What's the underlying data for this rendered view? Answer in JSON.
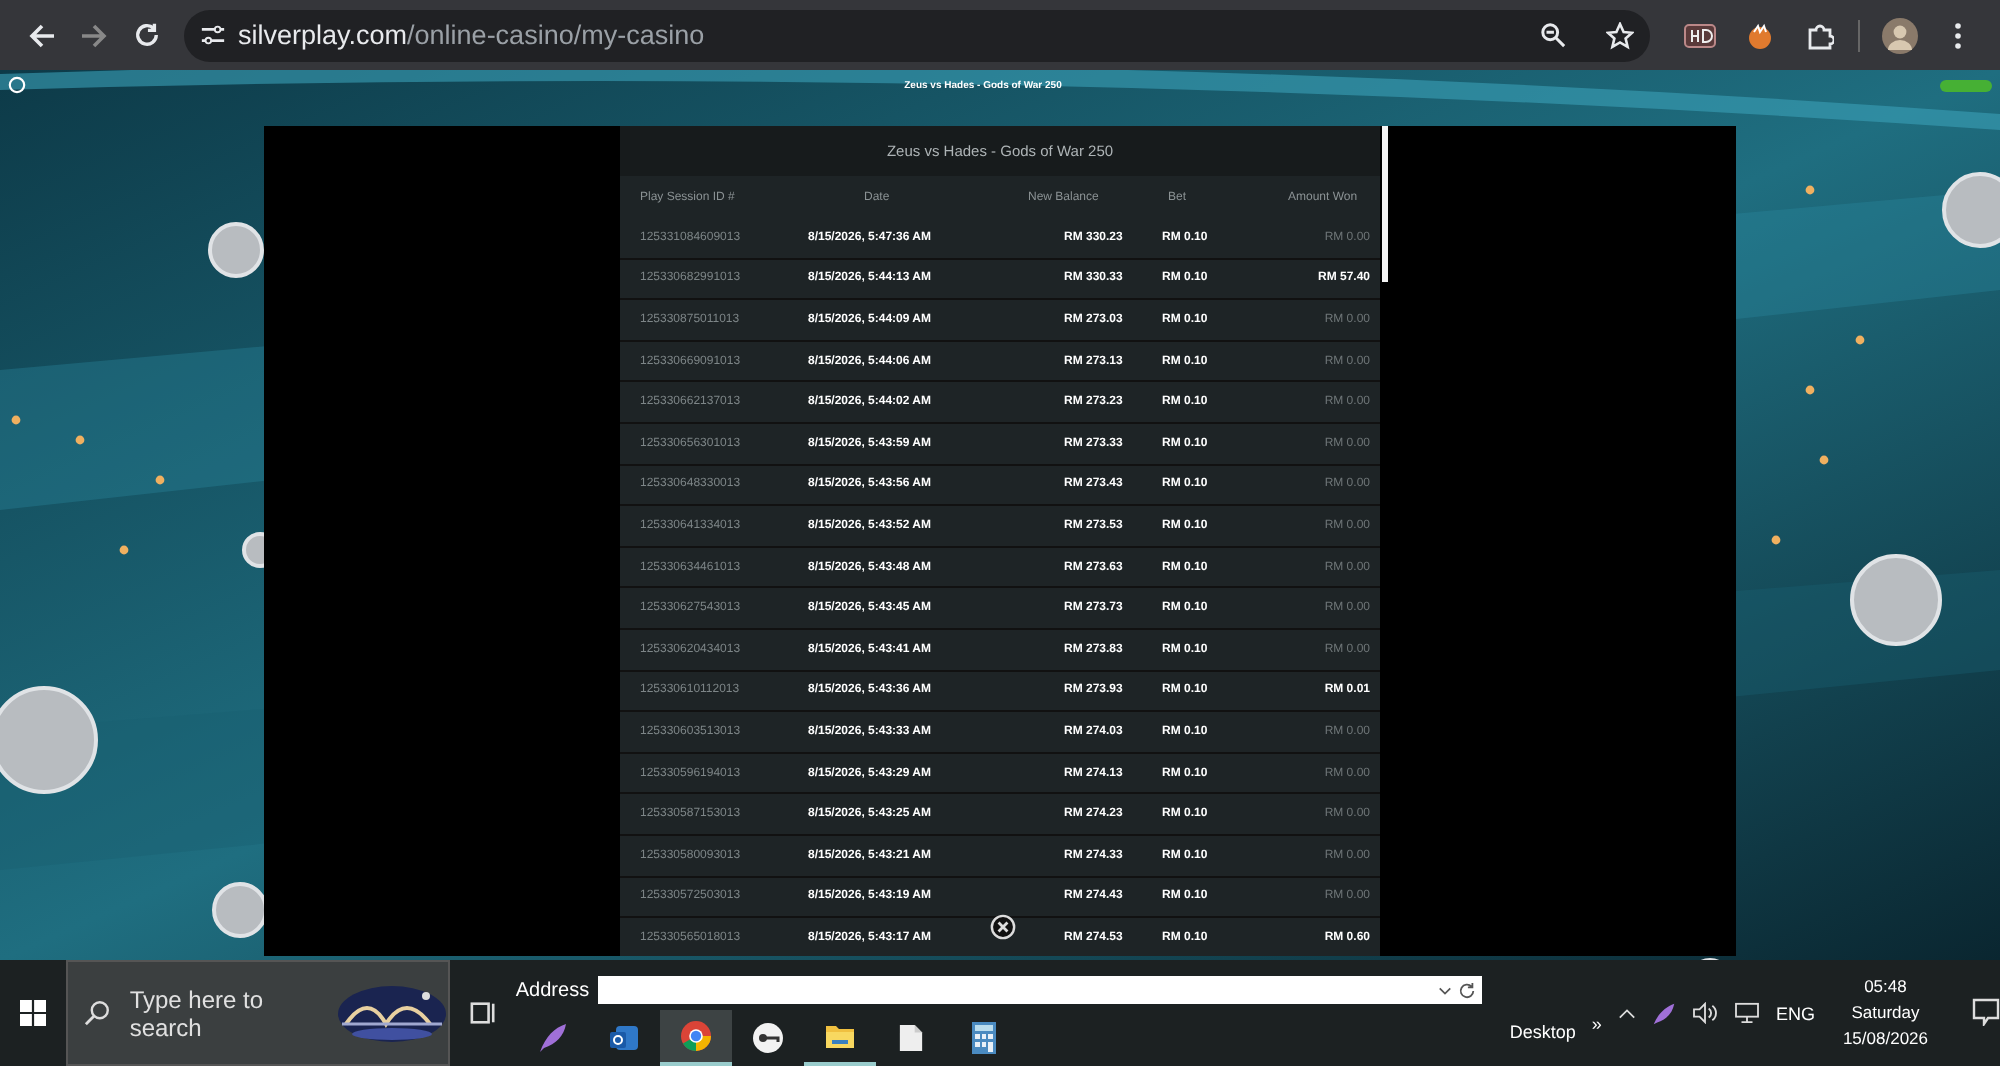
{
  "browser": {
    "url_host": "silverplay.com",
    "url_path": "/online-casino/my-casino"
  },
  "site": {
    "page_title": "Zeus vs Hades - Gods of War 250"
  },
  "history": {
    "title": "Zeus vs Hades - Gods of War 250",
    "columns": [
      "Play Session ID #",
      "Date",
      "New Balance",
      "Bet",
      "Amount Won"
    ],
    "rows": [
      {
        "id": "125331084609013",
        "date": "8/15/2026, 5:47:36 AM",
        "balance": "RM 330.23",
        "bet": "RM 0.10",
        "won": "RM 0.00",
        "win": false
      },
      {
        "id": "125330682991013",
        "date": "8/15/2026, 5:44:13 AM",
        "balance": "RM 330.33",
        "bet": "RM 0.10",
        "won": "RM 57.40",
        "win": true
      },
      {
        "id": "125330875011013",
        "date": "8/15/2026, 5:44:09 AM",
        "balance": "RM 273.03",
        "bet": "RM 0.10",
        "won": "RM 0.00",
        "win": false
      },
      {
        "id": "125330669091013",
        "date": "8/15/2026, 5:44:06 AM",
        "balance": "RM 273.13",
        "bet": "RM 0.10",
        "won": "RM 0.00",
        "win": false
      },
      {
        "id": "125330662137013",
        "date": "8/15/2026, 5:44:02 AM",
        "balance": "RM 273.23",
        "bet": "RM 0.10",
        "won": "RM 0.00",
        "win": false
      },
      {
        "id": "125330656301013",
        "date": "8/15/2026, 5:43:59 AM",
        "balance": "RM 273.33",
        "bet": "RM 0.10",
        "won": "RM 0.00",
        "win": false
      },
      {
        "id": "125330648330013",
        "date": "8/15/2026, 5:43:56 AM",
        "balance": "RM 273.43",
        "bet": "RM 0.10",
        "won": "RM 0.00",
        "win": false
      },
      {
        "id": "125330641334013",
        "date": "8/15/2026, 5:43:52 AM",
        "balance": "RM 273.53",
        "bet": "RM 0.10",
        "won": "RM 0.00",
        "win": false
      },
      {
        "id": "125330634461013",
        "date": "8/15/2026, 5:43:48 AM",
        "balance": "RM 273.63",
        "bet": "RM 0.10",
        "won": "RM 0.00",
        "win": false
      },
      {
        "id": "125330627543013",
        "date": "8/15/2026, 5:43:45 AM",
        "balance": "RM 273.73",
        "bet": "RM 0.10",
        "won": "RM 0.00",
        "win": false
      },
      {
        "id": "125330620434013",
        "date": "8/15/2026, 5:43:41 AM",
        "balance": "RM 273.83",
        "bet": "RM 0.10",
        "won": "RM 0.00",
        "win": false
      },
      {
        "id": "125330610112013",
        "date": "8/15/2026, 5:43:36 AM",
        "balance": "RM 273.93",
        "bet": "RM 0.10",
        "won": "RM 0.01",
        "win": true
      },
      {
        "id": "125330603513013",
        "date": "8/15/2026, 5:43:33 AM",
        "balance": "RM 274.03",
        "bet": "RM 0.10",
        "won": "RM 0.00",
        "win": false
      },
      {
        "id": "125330596194013",
        "date": "8/15/2026, 5:43:29 AM",
        "balance": "RM 274.13",
        "bet": "RM 0.10",
        "won": "RM 0.00",
        "win": false
      },
      {
        "id": "125330587153013",
        "date": "8/15/2026, 5:43:25 AM",
        "balance": "RM 274.23",
        "bet": "RM 0.10",
        "won": "RM 0.00",
        "win": false
      },
      {
        "id": "125330580093013",
        "date": "8/15/2026, 5:43:21 AM",
        "balance": "RM 274.33",
        "bet": "RM 0.10",
        "won": "RM 0.00",
        "win": false
      },
      {
        "id": "125330572503013",
        "date": "8/15/2026, 5:43:19 AM",
        "balance": "RM 274.43",
        "bet": "RM 0.10",
        "won": "RM 0.00",
        "win": false
      },
      {
        "id": "125330565018013",
        "date": "8/15/2026, 5:43:17 AM",
        "balance": "RM 274.53",
        "bet": "RM 0.10",
        "won": "RM 0.60",
        "win": true
      }
    ]
  },
  "taskbar": {
    "search_placeholder": "Type here to search",
    "address_label": "Address",
    "desktop_label": "Desktop",
    "overflow": "»",
    "language": "ENG",
    "time": "05:48",
    "day": "Saturday",
    "date": "15/08/2026"
  }
}
